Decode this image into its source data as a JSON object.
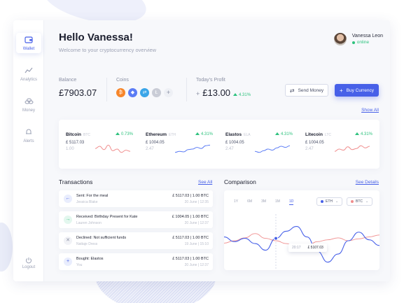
{
  "sidebar": {
    "items": [
      {
        "label": "Wallet",
        "icon": "wallet-icon"
      },
      {
        "label": "Analytics",
        "icon": "analytics-icon"
      },
      {
        "label": "Money",
        "icon": "money-icon"
      },
      {
        "label": "Alerts",
        "icon": "alerts-icon"
      }
    ],
    "logout": "Logout"
  },
  "header": {
    "greeting": "Hello Vanessa!",
    "subtitle": "Welcome to your cryptocurrency overview"
  },
  "user": {
    "name": "Vanessa Leon",
    "status": "online"
  },
  "stats": {
    "balance_label": "Balance",
    "balance_value": "£7903.07",
    "coins_label": "Coins",
    "coins": [
      {
        "name": "Bitcoin",
        "glyph": "₿",
        "color": "#f7862a"
      },
      {
        "name": "Ethereum",
        "glyph": "◆",
        "color": "#5b7cf5"
      },
      {
        "name": "Elastos",
        "glyph": "⇄",
        "color": "#3aa5e8"
      },
      {
        "name": "Litecoin",
        "glyph": "Ł",
        "color": "#c9ccd6"
      }
    ],
    "add_coin": "+",
    "profit_label": "Today's Profit",
    "profit_sign": "+",
    "profit_value": "£13.00",
    "profit_change": "4.31%"
  },
  "actions": {
    "send": "Send Money",
    "buy": "Buy Currency"
  },
  "show_all": "Show All",
  "tickers": [
    {
      "name": "Bitcoin",
      "symbol": "BTC",
      "change": "0.73%",
      "price": "£ 5117.03",
      "amount": "1.00",
      "color": "#f08d8d",
      "points": [
        0.55,
        0.75,
        0.45,
        0.85,
        0.35,
        0.5,
        0.2,
        0.4,
        0.3
      ]
    },
    {
      "name": "Ethereum",
      "symbol": "ETH",
      "change": "4.31%",
      "price": "£ 1004.05",
      "amount": "2.47",
      "color": "#5b7cf5",
      "points": [
        0.2,
        0.3,
        0.25,
        0.45,
        0.5,
        0.65,
        0.55,
        0.8,
        0.85
      ]
    },
    {
      "name": "Elastos",
      "symbol": "ELA",
      "change": "4.31%",
      "price": "£ 1004.05",
      "amount": "2.47",
      "color": "#5b7cf5",
      "points": [
        0.3,
        0.2,
        0.35,
        0.5,
        0.4,
        0.6,
        0.75,
        0.65,
        0.8
      ]
    },
    {
      "name": "Litecoin",
      "symbol": "LTC",
      "change": "4.31%",
      "price": "£ 1004.05",
      "amount": "2.47",
      "color": "#f08d8d",
      "points": [
        0.3,
        0.5,
        0.4,
        0.7,
        0.45,
        0.55,
        0.8,
        0.6,
        0.75
      ]
    }
  ],
  "transactions": {
    "title": "Transactions",
    "see_all": "See All",
    "items": [
      {
        "type": "sent",
        "glyph": "←",
        "bg": "#e9edfd",
        "fg": "#4760e8",
        "name": "Sent: For the meal",
        "who": "Jessica Blake",
        "amount": "£ 5117.03 | 1.00 BTC",
        "date": "20 June | 12:35"
      },
      {
        "type": "received",
        "glyph": "→",
        "bg": "#e3f7ee",
        "fg": "#2ec27e",
        "name": "Received: Birthday Present for Kate",
        "who": "Lauren Johnson",
        "amount": "£ 1004.05 | 1.00 BTC",
        "date": "20 June | 12:37"
      },
      {
        "type": "declined",
        "glyph": "✕",
        "bg": "#f1f2f6",
        "fg": "#8b90a4",
        "name": "Declined: Not sufficient funds",
        "who": "Nattaje Dress",
        "amount": "£ 5117.03 | 1.00 BTC",
        "date": "19 June | 15:10"
      },
      {
        "type": "bought",
        "glyph": "+",
        "bg": "#e9edfd",
        "fg": "#4760e8",
        "name": "Bought: Elastos",
        "who": "You",
        "amount": "£ 5117.03 | 1.00 BTC",
        "date": "20 June | 12:37"
      }
    ]
  },
  "comparison": {
    "title": "Comparison",
    "see_details": "See Details",
    "ranges": [
      "1Y",
      "6M",
      "3M",
      "1M",
      "1D"
    ],
    "active_range": "1D",
    "dropdowns": [
      {
        "label": "ETH",
        "color": "#4760e8"
      },
      {
        "label": "BTC",
        "color": "#f08d8d"
      }
    ],
    "tooltip_left": "20:17",
    "tooltip_right": "£ 5107.03"
  },
  "chart_data": {
    "type": "line",
    "title": "",
    "series": [
      {
        "name": "ETH",
        "color": "#4760e8",
        "values": [
          0.42,
          0.52,
          0.45,
          0.56,
          0.7,
          0.45,
          0.3,
          0.2,
          0.42,
          0.72,
          0.95,
          0.78,
          0.5,
          0.32,
          0.48,
          0.6
        ]
      },
      {
        "name": "BTC",
        "color": "#f08d8d",
        "values": [
          0.55,
          0.5,
          0.44,
          0.35,
          0.45,
          0.5,
          0.56,
          0.6,
          0.62,
          0.52,
          0.48,
          0.44,
          0.5,
          0.46,
          0.42,
          0.38
        ]
      }
    ]
  }
}
